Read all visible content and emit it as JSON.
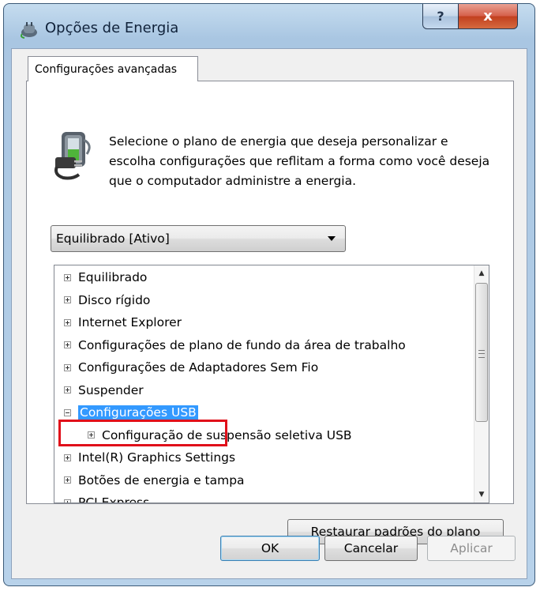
{
  "window": {
    "title": "Opções de Energia",
    "help_label": "?",
    "close_label": "x"
  },
  "tab": {
    "label": "Configurações avançadas"
  },
  "description": "Selecione o plano de energia que deseja personalizar e escolha configurações que reflitam a forma como você deseja que o computador administre a energia.",
  "plan_select": {
    "value": "Equilibrado [Ativo]"
  },
  "tree": {
    "items": [
      {
        "label": "Equilibrado",
        "expander": "plus",
        "level": 0
      },
      {
        "label": "Disco rígido",
        "expander": "plus",
        "level": 0
      },
      {
        "label": "Internet Explorer",
        "expander": "plus",
        "level": 0
      },
      {
        "label": "Configurações de plano de fundo da área de trabalho",
        "expander": "plus",
        "level": 0
      },
      {
        "label": "Configurações de Adaptadores Sem Fio",
        "expander": "plus",
        "level": 0
      },
      {
        "label": "Suspender",
        "expander": "plus",
        "level": 0
      },
      {
        "label": "Configurações USB",
        "expander": "minus",
        "level": 0,
        "selected": true
      },
      {
        "label": "Configuração de suspensão seletiva USB",
        "expander": "plus",
        "level": 1
      },
      {
        "label": "Intel(R) Graphics Settings",
        "expander": "plus",
        "level": 0
      },
      {
        "label": "Botões de energia e tampa",
        "expander": "plus",
        "level": 0
      },
      {
        "label": "PCI Express",
        "expander": "plus",
        "level": 0
      }
    ]
  },
  "buttons": {
    "restore": "Restaurar padrões do plano",
    "ok": "OK",
    "cancel": "Cancelar",
    "apply": "Aplicar"
  },
  "colors": {
    "selection": "#3399ff",
    "highlight_box": "#e0101a",
    "close_button": "#c2401f"
  },
  "icons": {
    "app": "power-plug-icon",
    "description": "power-plug-battery-icon"
  }
}
